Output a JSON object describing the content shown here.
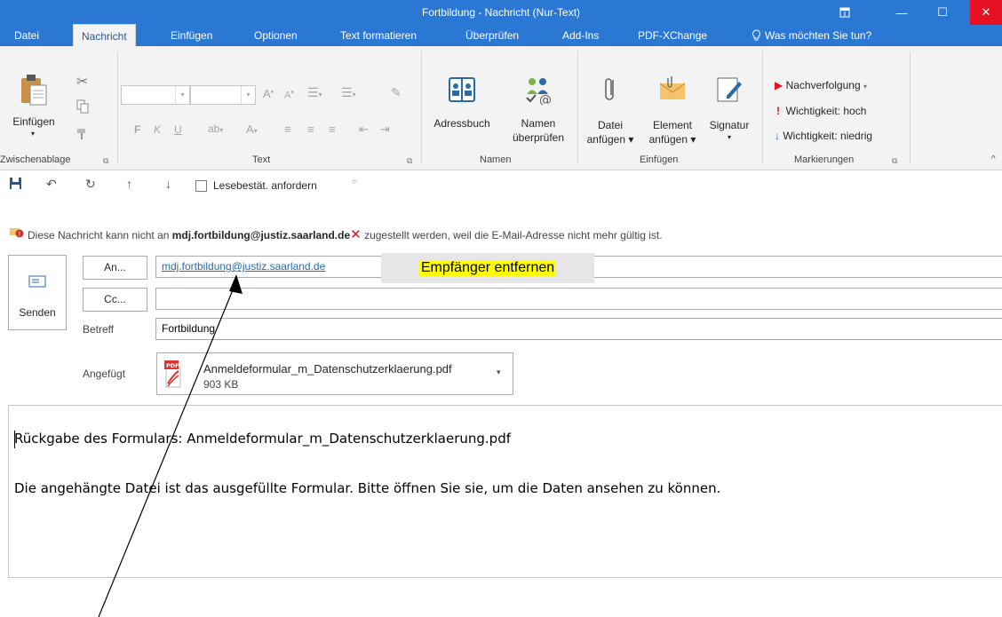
{
  "window": {
    "title": "Fortbildung - Nachricht (Nur-Text)",
    "min_glyph": "—",
    "max_glyph": "☐",
    "close_glyph": "✕"
  },
  "tabs": {
    "datei": "Datei",
    "nachricht": "Nachricht",
    "einfuegen": "Einfügen",
    "optionen": "Optionen",
    "text_formatieren": "Text formatieren",
    "ueberpruefen": "Überprüfen",
    "add_ins": "Add-Ins",
    "pdf_xchange": "PDF-XChange",
    "tell_me": "Was möchten Sie tun?"
  },
  "ribbon": {
    "clipboard": {
      "paste_label": "Einfügen",
      "group_label": "Zwischenablage"
    },
    "text": {
      "group_label": "Text",
      "bold": "F",
      "italic": "K",
      "underline": "U",
      "grow": "A",
      "shrink": "A"
    },
    "names": {
      "group_label": "Namen",
      "addressbook": "Adressbuch",
      "check_names_1": "Namen",
      "check_names_2": "überprüfen"
    },
    "include": {
      "group_label": "Einfügen",
      "attach_file_1": "Datei",
      "attach_file_2": "anfügen",
      "attach_item_1": "Element",
      "attach_item_2": "anfügen",
      "signature": "Signatur"
    },
    "tags": {
      "group_label": "Markierungen",
      "follow_up": "Nachverfolgung",
      "high": "Wichtigkeit: hoch",
      "low": "Wichtigkeit: niedrig"
    }
  },
  "qat": {
    "read_receipt": "Lesebestät. anfordern"
  },
  "infobar": {
    "prefix": "Diese Nachricht kann nicht an",
    "address": "mdj.fortbildung@justiz.saarland.de",
    "suffix": "zugestellt werden, weil die E-Mail-Adresse nicht mehr gültig ist."
  },
  "compose": {
    "send": "Senden",
    "to_btn": "An...",
    "cc_btn": "Cc...",
    "to_value": "mdj.fortbildung@justiz.saarland.de",
    "subject_label": "Betreff",
    "subject_value": "Fortbildung",
    "attached_label": "Angefügt",
    "attachment_name": "Anmeldeformular_m_Datenschutzerklaerung.pdf",
    "attachment_size": "903 KB",
    "attachment_icon": "PDF"
  },
  "tooltip": {
    "text": "Empfänger entfernen"
  },
  "body": {
    "line1": "Rückgabe des Formulars: Anmeldeformular_m_Datenschutzerklaerung.pdf",
    "line2": "Die angehängte Datei ist das ausgefüllte Formular. Bitte öffnen Sie sie, um die Daten ansehen zu können."
  },
  "colors": {
    "titlebar": "#2b78d4",
    "close": "#e81123",
    "ribbon": "#f3f3f3",
    "highlight": "#ffff00",
    "error_x": "#e81123",
    "link": "#2b6aa8"
  }
}
